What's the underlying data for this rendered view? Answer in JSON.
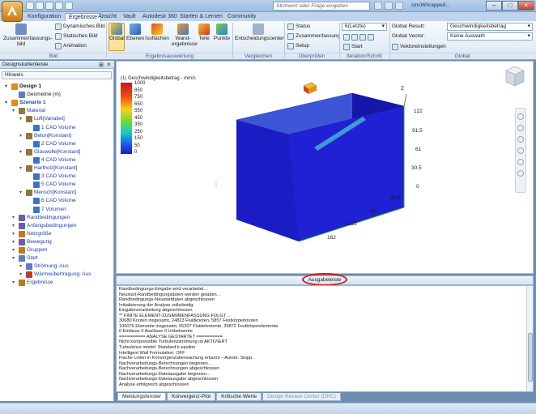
{
  "app": {
    "search_placeholder": "Stichwort oder Frage eingeben",
    "user": "sim360capped..."
  },
  "tabs": [
    "Konfiguration",
    "Ergebnisse",
    "Ansicht",
    "Vault",
    "Autodesk 360",
    "Starten & Lernen",
    "Community"
  ],
  "ribbon": {
    "bild": {
      "big": "Zusammenfassungs-bild",
      "items": [
        "Dynamisches Bild",
        "Statisches Bild",
        "Animation"
      ],
      "label": "Bild"
    },
    "ergebnisauswertung": {
      "buttons": [
        "Global",
        "Ebenen",
        "Isoflächen",
        "Wand-ergebnisse",
        "Teile",
        "Punkte"
      ],
      "label": "Ergebnisauswertung"
    },
    "vergleichen": {
      "button": "Entscheidungscenter",
      "label": "Vergleichen"
    },
    "ueberpruefen": {
      "items": [
        "Status",
        "Zusammenfassung",
        "Setup"
      ],
      "label": "Überprüfen"
    },
    "iteration": {
      "combo": "6(Letzte)",
      "start": "Start",
      "label": "Iteration/Schritt"
    },
    "global": {
      "result_label": "Global Result:",
      "result_value": "Geschwindigkeitsbetrag",
      "vector_label": "Global Vector:",
      "vector_value": "Keine Auswahl",
      "vector_settings": "Vektoreinstellungen",
      "label": "Global"
    }
  },
  "sidebar": {
    "title": "Designstudienleiste",
    "hint": "Hinweis",
    "tree": [
      {
        "label": "Design 1",
        "level": 0,
        "icon": "design-icon",
        "color": "#e08b1a"
      },
      {
        "label": "Geometrie (m)",
        "level": 1,
        "icon": "geometry-icon",
        "color": "#5a7ec0"
      },
      {
        "label": "Szenario 1",
        "level": 0,
        "icon": "scenario-icon",
        "color": "#e08b1a"
      },
      {
        "label": "Material",
        "level": 1,
        "icon": "material-icon",
        "color": "#8a7a3a"
      },
      {
        "label": "Luft[Variabel]",
        "level": 2,
        "icon": "material-icon",
        "color": "#8a7a3a"
      },
      {
        "label": "1 CAD Volume",
        "level": 3,
        "icon": "volume-icon",
        "color": "#3f74c4"
      },
      {
        "label": "Beton[Konstant]",
        "level": 2,
        "icon": "material-icon",
        "color": "#8a7a3a"
      },
      {
        "label": "2 CAD Volume",
        "level": 3,
        "icon": "volume-icon",
        "color": "#3f74c4"
      },
      {
        "label": "Glaswolle[Konstant]",
        "level": 2,
        "icon": "material-icon",
        "color": "#8a7a3a"
      },
      {
        "label": "4 CAD Volume",
        "level": 3,
        "icon": "volume-icon",
        "color": "#3f74c4"
      },
      {
        "label": "Hartholz[Konstant]",
        "level": 2,
        "icon": "material-icon",
        "color": "#8a7a3a"
      },
      {
        "label": "3 CAD Volume",
        "level": 3,
        "icon": "volume-icon",
        "color": "#3f74c4"
      },
      {
        "label": "5 CAD Volume",
        "level": 3,
        "icon": "volume-icon",
        "color": "#3f74c4"
      },
      {
        "label": "Mensch[Konstant]",
        "level": 2,
        "icon": "material-icon",
        "color": "#8a7a3a"
      },
      {
        "label": "6 CAD Volume",
        "level": 3,
        "icon": "volume-icon",
        "color": "#3f74c4"
      },
      {
        "label": "7 Volumen",
        "level": 3,
        "icon": "volume-icon",
        "color": "#3f74c4"
      },
      {
        "label": "Randbedingungen",
        "level": 1,
        "icon": "boundary-icon",
        "color": "#6f5aa8"
      },
      {
        "label": "Anfangsbedingungen",
        "level": 1,
        "icon": "initial-condition-icon",
        "color": "#6f5aa8"
      },
      {
        "label": "Netzgröße",
        "level": 1,
        "icon": "mesh-icon",
        "color": "#c07a1a"
      },
      {
        "label": "Bewegung",
        "level": 1,
        "icon": "motion-icon",
        "color": "#6f5aa8"
      },
      {
        "label": "Gruppen",
        "level": 1,
        "icon": "groups-icon",
        "color": "#c07a1a"
      },
      {
        "label": "Start",
        "level": 1,
        "icon": "solve-icon",
        "color": "#5a7ec0"
      },
      {
        "label": "Strömung: Aus",
        "level": 2,
        "icon": "flow-icon",
        "color": "#5a7ec0"
      },
      {
        "label": "Wärmeübertragung: Aus",
        "level": 2,
        "icon": "heat-icon",
        "color": "#c0392b"
      },
      {
        "label": "Ergebnisse",
        "level": 1,
        "icon": "results-icon",
        "color": "#c07a1a"
      }
    ]
  },
  "viewport": {
    "legend_title": "(1) Geschwindigkeitsbetrag - mm/s",
    "legend_ticks": [
      "1000",
      "850",
      "750",
      "650",
      "550",
      "450",
      "350",
      "250",
      "150",
      "50",
      "0"
    ],
    "axis_right": [
      "122",
      "91.5",
      "61",
      "30.5",
      "0"
    ],
    "axis_front": [
      "40.5",
      "81",
      "122",
      "162"
    ],
    "axis_z": "Z"
  },
  "output": {
    "tab_label": "Ausgabeleiste",
    "lines": [
      "Randbedingungs-Eingabe wird verarbeitet…",
      "Neustart-Randbedingungsdaten werden geladen…",
      "Randbedingungs-Neustartdaten abgeschlossen",
      "Initialisierung der Analyse vollständig.",
      "Eingabeverarbeitung abgeschlossen",
      "** FINITE ELEMENT-ZUSAMMENFASSUNG FOLGT…",
      "30680 Knoten insgesamt,   24823 Fluidknoten,   5857 Festkörperknoten",
      "105079 Elemente insgesamt,   65207 Fluidelemente,   39872 Festkörperelemente",
      "0 Einlässe   0 Auslässe   0 Unbekannte",
      "========== ANALYSE GESTARTET ==========",
      "Nicht kompressible Turbulenzströmung ist AKTIVIERT",
      "Turbulence model: Standard k-epsilon",
      "Intelligent Wall Formulation: OFF",
      "Flache Linien in Konvergenzüberwachung erkannt – Autom. Stopp.",
      "Nachverarbeitungs-Berechnungen beginnen…",
      "Nachverarbeitungs-Berechnungen abgeschlossen",
      "Nachverarbeitungs-Dateiausgabe beginnen…",
      "Nachverarbeitungs-Dateiausgabe abgeschlossen",
      "Analyse erfolgreich abgeschlossen"
    ],
    "bottom_tabs": [
      "Meldungsfenster",
      "Konvergenz-Plot",
      "Kritische Werte",
      "Design Review Center (DRC)"
    ]
  },
  "colors": {
    "box_top": "#3d56d8",
    "box_front": "#1f1fd0",
    "box_side": "#1616a8",
    "highlight_ring": "#c81e1e"
  }
}
